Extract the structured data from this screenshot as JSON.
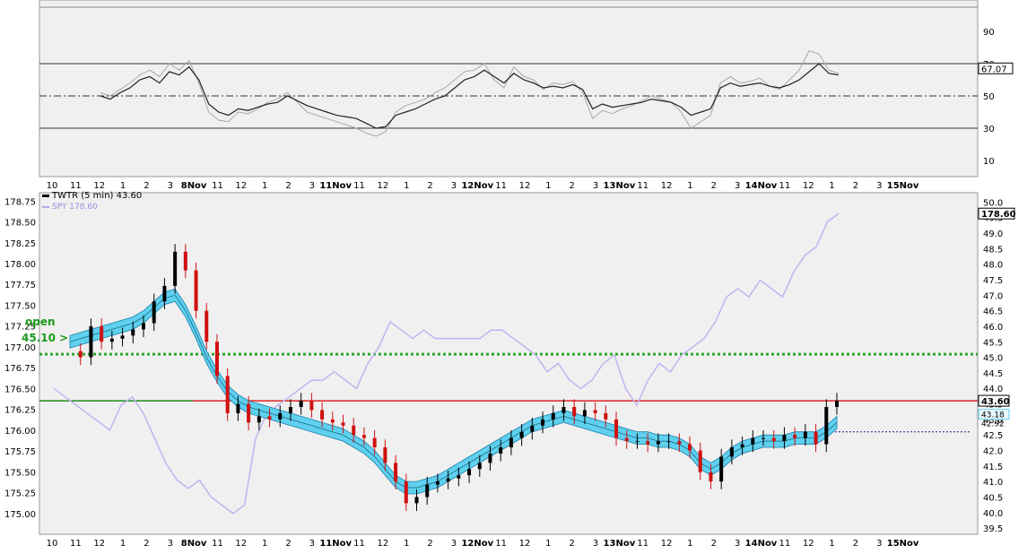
{
  "chart_data": [
    {
      "type": "line",
      "name": "upper-oscillator",
      "ylim": [
        0,
        105
      ],
      "y_ticks": [
        "90",
        "70",
        "50",
        "30",
        "10"
      ],
      "y_tick_values": [
        90,
        70,
        50,
        30,
        10
      ],
      "reference_lines": [
        70,
        50,
        30
      ],
      "last_value_label": "67.07",
      "series": [
        {
          "values": [
            50,
            48,
            52,
            55,
            60,
            62,
            58,
            65,
            63,
            68,
            60,
            45,
            40,
            38,
            42,
            41,
            43,
            45,
            46,
            50,
            47,
            44,
            42,
            40,
            38,
            37,
            36,
            33,
            30,
            31,
            38,
            40,
            42,
            45,
            48,
            50,
            55,
            60,
            62,
            66,
            62,
            58,
            64,
            60,
            58,
            55,
            56,
            55,
            57,
            54,
            42,
            45,
            43,
            44,
            45,
            46,
            48,
            47,
            46,
            43,
            38,
            40,
            42,
            55,
            58,
            56,
            57,
            58,
            56,
            55,
            57,
            60,
            65,
            70,
            64,
            63
          ]
        },
        {
          "values": [
            52,
            50,
            54,
            58,
            63,
            66,
            62,
            70,
            66,
            72,
            58,
            40,
            35,
            34,
            40,
            39,
            42,
            46,
            48,
            52,
            46,
            40,
            38,
            36,
            34,
            32,
            30,
            27,
            25,
            28,
            40,
            44,
            46,
            48,
            52,
            55,
            60,
            65,
            66,
            70,
            60,
            55,
            68,
            62,
            60,
            54,
            58,
            57,
            59,
            52,
            36,
            41,
            39,
            42,
            44,
            47,
            50,
            48,
            46,
            40,
            30,
            34,
            38,
            58,
            62,
            58,
            59,
            61,
            56,
            54,
            60,
            66,
            78,
            76,
            66,
            64
          ]
        }
      ]
    },
    {
      "type": "line",
      "name": "price-chart",
      "title": "TWTR (5 min) 43.60",
      "series_labels": [
        "TWTR (5 min) 43.60",
        "SPY 178.60"
      ],
      "legend_spy": "SPY 178.60",
      "ylim_left": [
        174.75,
        178.85
      ],
      "ylim_right": [
        39.3,
        50.3
      ],
      "y_ticks_left": [
        "178.75",
        "178.50",
        "178.25",
        "178.00",
        "177.75",
        "177.50",
        "177.25",
        "177.00",
        "176.75",
        "176.50",
        "176.25",
        "176.00",
        "175.75",
        "175.50",
        "175.25",
        "175.00"
      ],
      "y_ticks_left_values": [
        178.75,
        178.5,
        178.25,
        178.0,
        177.75,
        177.5,
        177.25,
        177.0,
        176.75,
        176.5,
        176.25,
        176.0,
        175.75,
        175.5,
        175.25,
        175.0
      ],
      "y_ticks_right": [
        "50.0",
        "49.5",
        "49.0",
        "48.5",
        "48.0",
        "47.5",
        "47.0",
        "46.5",
        "46.0",
        "45.5",
        "45.0",
        "44.5",
        "44.0",
        "43.5",
        "43.0",
        "42.5",
        "42.0",
        "41.5",
        "41.0",
        "40.5",
        "40.0",
        "39.5"
      ],
      "y_ticks_right_values": [
        50.0,
        49.5,
        49.0,
        48.5,
        48.0,
        47.5,
        47.0,
        46.5,
        46.0,
        45.5,
        45.0,
        44.5,
        44.0,
        43.5,
        43.0,
        42.5,
        42.0,
        41.5,
        41.0,
        40.5,
        40.0,
        39.5
      ],
      "x_ticks": [
        "10",
        "11",
        "12",
        "1",
        "2",
        "3",
        "8Nov",
        "11",
        "12",
        "1",
        "2",
        "3",
        "11Nov",
        "11",
        "12",
        "1",
        "2",
        "3",
        "12Nov",
        "11",
        "12",
        "1",
        "2",
        "3",
        "13Nov",
        "11",
        "12",
        "1",
        "2",
        "3",
        "14Nov",
        "11",
        "12",
        "1",
        "2",
        "3",
        "15Nov"
      ],
      "price_labels": {
        "spy_last": "178.60",
        "twtr_last": "43.60",
        "band_upper": "43.18",
        "band_lower": "42.92"
      },
      "open_label": "open",
      "open_value_label": "45.10 >",
      "horizontal_levels": {
        "open_dotted": 45.1,
        "red_line": 43.6,
        "blue_dashed": 42.6
      },
      "twtr_close": [
        45.2,
        45.0,
        46.0,
        45.5,
        45.6,
        45.7,
        45.9,
        46.1,
        46.8,
        47.3,
        48.4,
        47.8,
        46.5,
        45.5,
        44.4,
        43.2,
        43.5,
        42.9,
        43.1,
        43.0,
        43.2,
        43.4,
        43.6,
        43.3,
        43.0,
        42.9,
        42.8,
        42.5,
        42.4,
        42.1,
        41.6,
        41.0,
        40.3,
        40.5,
        40.9,
        41.0,
        41.1,
        41.2,
        41.4,
        41.6,
        41.9,
        42.1,
        42.4,
        42.6,
        42.8,
        43.0,
        43.2,
        43.4,
        43.1,
        43.3,
        43.2,
        43.0,
        42.4,
        42.3,
        42.3,
        42.2,
        42.3,
        42.3,
        42.2,
        42.0,
        41.3,
        41.0,
        41.8,
        42.1,
        42.2,
        42.4,
        42.4,
        42.3,
        42.5,
        42.4,
        42.6,
        42.2,
        43.4,
        43.6
      ],
      "twtr_ma": [
        45.5,
        45.6,
        45.7,
        45.8,
        45.9,
        46.0,
        46.1,
        46.3,
        46.6,
        46.9,
        47.0,
        46.5,
        45.8,
        45.0,
        44.4,
        43.9,
        43.6,
        43.4,
        43.3,
        43.2,
        43.1,
        43.0,
        42.9,
        42.8,
        42.7,
        42.6,
        42.5,
        42.3,
        42.1,
        41.8,
        41.4,
        41.0,
        40.8,
        40.8,
        40.9,
        41.0,
        41.2,
        41.4,
        41.6,
        41.8,
        42.0,
        42.2,
        42.4,
        42.6,
        42.8,
        42.9,
        43.0,
        43.1,
        43.0,
        42.9,
        42.8,
        42.7,
        42.6,
        42.5,
        42.4,
        42.4,
        42.3,
        42.3,
        42.2,
        42.0,
        41.6,
        41.4,
        41.6,
        41.9,
        42.1,
        42.2,
        42.3,
        42.3,
        42.3,
        42.4,
        42.4,
        42.4,
        42.6,
        42.9
      ],
      "spy_close": [
        176.5,
        176.4,
        176.3,
        176.2,
        176.1,
        176.0,
        176.3,
        176.4,
        176.2,
        175.9,
        175.6,
        175.4,
        175.3,
        175.4,
        175.2,
        175.1,
        175.0,
        175.1,
        175.9,
        176.2,
        176.3,
        176.4,
        176.5,
        176.6,
        176.6,
        176.7,
        176.6,
        176.5,
        176.8,
        177.0,
        177.3,
        177.2,
        177.1,
        177.2,
        177.1,
        177.1,
        177.1,
        177.1,
        177.1,
        177.2,
        177.2,
        177.1,
        177.0,
        176.9,
        176.7,
        176.8,
        176.6,
        176.5,
        176.6,
        176.8,
        176.9,
        176.5,
        176.3,
        176.6,
        176.8,
        176.7,
        176.9,
        177.0,
        177.1,
        177.3,
        177.6,
        177.7,
        177.6,
        177.8,
        177.7,
        177.6,
        177.9,
        178.1,
        178.2,
        178.5,
        178.6
      ]
    }
  ]
}
